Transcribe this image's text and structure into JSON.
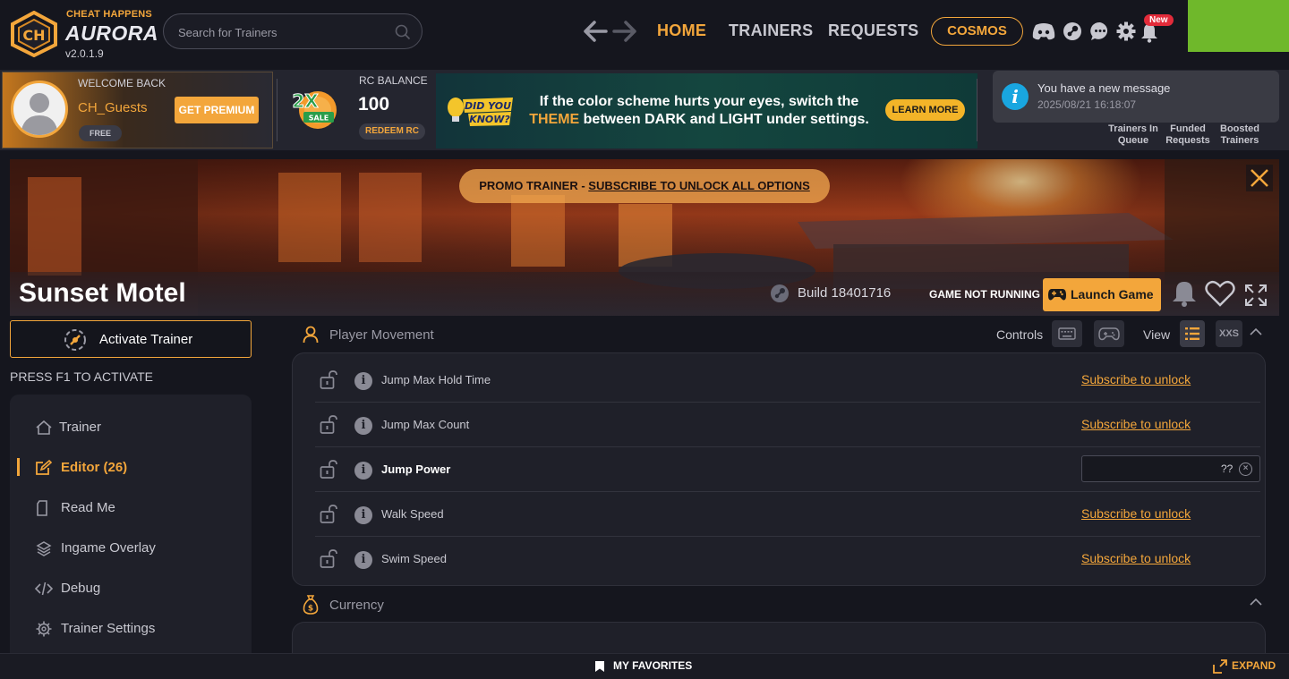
{
  "brand": {
    "name_top": "CHEAT HAPPENS",
    "name_main": "AURORA",
    "version": "v2.0.1.9"
  },
  "search": {
    "placeholder": "Search for Trainers"
  },
  "nav": {
    "home": "HOME",
    "trainers": "TRAINERS",
    "requests": "REQUESTS",
    "cosmos": "COSMOS",
    "new_badge": "New"
  },
  "account": {
    "welcome": "WELCOME BACK",
    "username": "CH_Guests",
    "tier": "FREE",
    "get_premium": "GET PREMIUM"
  },
  "sale": {
    "multiplier": "2X",
    "label": "SALE"
  },
  "rc": {
    "label": "RC BALANCE",
    "value": "100",
    "redeem": "REDEEM RC"
  },
  "tip": {
    "badge_line1": "DID YOU",
    "badge_line2": "KNOW?",
    "line1": "If the color scheme hurts your eyes, switch the",
    "highlight": "THEME",
    "line2_rest": " between DARK and LIGHT under settings.",
    "learn_more": "LEARN MORE"
  },
  "stats": [
    {
      "line1": "Trainers In",
      "line2": "Queue"
    },
    {
      "line1": "Funded",
      "line2": "Requests"
    },
    {
      "line1": "Boosted",
      "line2": "Trainers"
    }
  ],
  "notification": {
    "title": "You have a new message",
    "time": "2025/08/21 16:18:07"
  },
  "game": {
    "promo_prefix": "PROMO TRAINER - ",
    "promo_link": "SUBSCRIBE TO UNLOCK ALL OPTIONS",
    "title": "Sunset Motel",
    "build": "Build 18401716",
    "status": "GAME NOT RUNNING",
    "launch": "Launch Game"
  },
  "trainer": {
    "activate": "Activate Trainer",
    "hotkey_hint": "PRESS F1 TO ACTIVATE"
  },
  "sidebar": {
    "items": [
      {
        "label": "Trainer",
        "icon": "home-icon"
      },
      {
        "label": "Editor (26)",
        "icon": "edit-icon",
        "active": true
      },
      {
        "label": "Read Me",
        "icon": "document-icon"
      },
      {
        "label": "Ingame Overlay",
        "icon": "layers-icon"
      },
      {
        "label": "Debug",
        "icon": "code-icon"
      },
      {
        "label": "Trainer Settings",
        "icon": "gear-icon"
      }
    ]
  },
  "editor": {
    "controls_label": "Controls",
    "view_label": "View",
    "view_compact": "XXS",
    "sections": [
      {
        "title": "Player Movement",
        "rows": [
          {
            "name": "Jump Max Hold Time",
            "action": "Subscribe to unlock"
          },
          {
            "name": "Jump Max Count",
            "action": "Subscribe to unlock"
          },
          {
            "name": "Jump Power",
            "value": "??"
          },
          {
            "name": "Walk Speed",
            "action": "Subscribe to unlock"
          },
          {
            "name": "Swim Speed",
            "action": "Subscribe to unlock"
          }
        ]
      },
      {
        "title": "Currency"
      }
    ]
  },
  "footer": {
    "favorites": "MY FAVORITES",
    "expand": "EXPAND"
  },
  "colors": {
    "accent": "#f3a63b",
    "background": "#15161e",
    "panel": "#1f2029",
    "info_blue": "#19a6e0",
    "badge_red": "#e22b3a"
  }
}
